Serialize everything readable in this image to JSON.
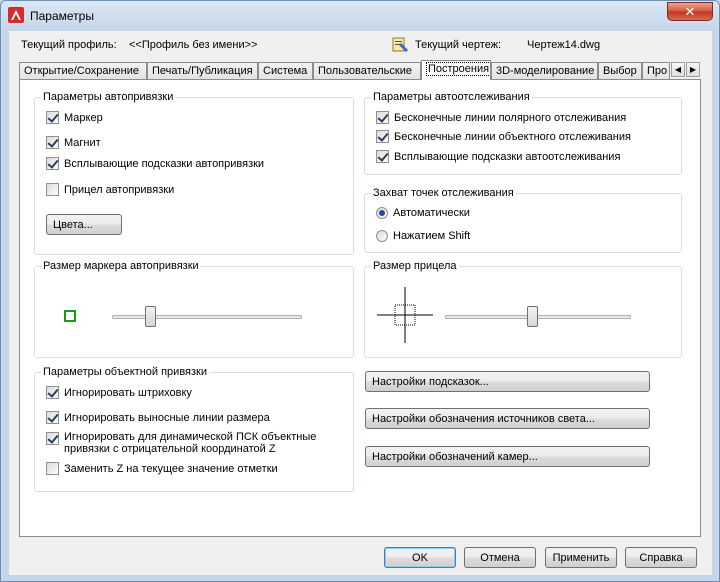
{
  "window": {
    "title": "Параметры",
    "close_label": "✕"
  },
  "header": {
    "profile_label": "Текущий профиль:",
    "profile_value": "<<Профиль без имени>>",
    "drawing_label": "Текущий чертеж:",
    "drawing_value": "Чертеж14.dwg"
  },
  "tabs": [
    "Открытие/Сохранение",
    "Печать/Публикация",
    "Система",
    "Пользовательские",
    "Построения",
    "3D-моделирование",
    "Выбор",
    "Про"
  ],
  "active_tab": "Построения",
  "autosnap": {
    "title": "Параметры автопривязки",
    "items": [
      {
        "label": "Маркер",
        "checked": true
      },
      {
        "label": "Магнит",
        "checked": true
      },
      {
        "label": "Всплывающие подсказки автопривязки",
        "checked": true
      },
      {
        "label": "Прицел автопривязки",
        "checked": false
      }
    ],
    "colors_button": "Цвета..."
  },
  "autotrack": {
    "title": "Параметры автоотслеживания",
    "items": [
      {
        "label": "Бесконечные линии полярного отслеживания",
        "checked": true
      },
      {
        "label": "Бесконечные линии объектного отслеживания",
        "checked": true
      },
      {
        "label": "Всплывающие подсказки автоотслеживания",
        "checked": true
      }
    ]
  },
  "acquisition": {
    "title": "Захват точек отслеживания",
    "options": [
      {
        "label": "Автоматически",
        "selected": true
      },
      {
        "label": "Нажатием Shift",
        "selected": false
      }
    ]
  },
  "marker_size": {
    "title": "Размер маркера автопривязки",
    "value": 0.2
  },
  "aperture_size": {
    "title": "Размер прицела",
    "value": 0.47
  },
  "osnap": {
    "title": "Параметры объектной привязки",
    "items": [
      {
        "label": "Игнорировать штриховку",
        "checked": true
      },
      {
        "label": "Игнорировать выносные линии размера",
        "checked": true
      },
      {
        "label": "Игнорировать для динамической ПСК объектные привязки с отрицательной координатой Z",
        "checked": true
      },
      {
        "label": "Заменить Z на текущее значение отметки",
        "checked": false
      }
    ]
  },
  "side_buttons": {
    "tooltips": "Настройки подсказок...",
    "lights": "Настройки обозначения источников света...",
    "cameras": "Настройки обозначений камер..."
  },
  "footer": {
    "ok": "OK",
    "cancel": "Отмена",
    "apply": "Применить",
    "help": "Справка"
  },
  "colors": {
    "marker_green": "#1a9a1a",
    "close_red": "#c1371d"
  }
}
